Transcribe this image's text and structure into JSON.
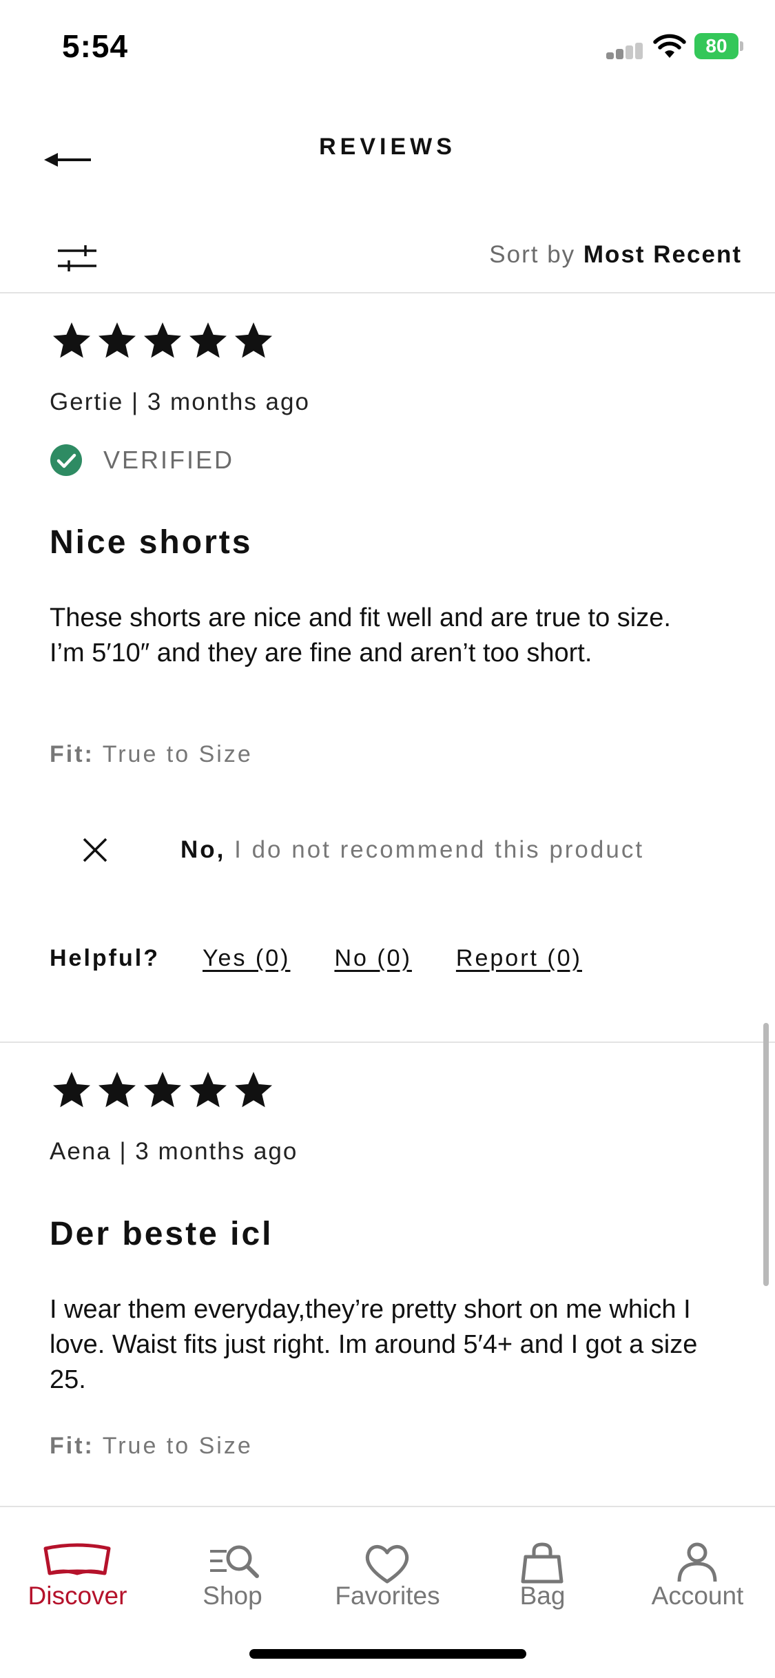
{
  "status_bar": {
    "time": "5:54",
    "battery": "80"
  },
  "header": {
    "title": "REVIEWS"
  },
  "toolbar": {
    "sort_prefix": "Sort by",
    "sort_value": "Most Recent"
  },
  "reviews": [
    {
      "rating": 5,
      "reviewer": "Gertie | 3 months ago",
      "verified": "VERIFIED",
      "title": "Nice shorts",
      "body": "These shorts are nice and fit well and are true to size. I’m 5′10″ and they are fine and aren’t too short.",
      "fit_label": "Fit:",
      "fit_value": "True to Size",
      "recommend_answer": "No,",
      "recommend_text": "I do not recommend this product",
      "helpful_label": "Helpful?",
      "helpful_yes": "Yes (0)",
      "helpful_no": "No (0)",
      "report": "Report (0)"
    },
    {
      "rating": 5,
      "reviewer": "Aena | 3 months ago",
      "title": "Der beste icl",
      "body": "I wear them everyday,they’re pretty short on me which I love. Waist fits just right. Im around 5′4+ and I got a size 25.",
      "fit_label": "Fit:",
      "fit_value": "True to Size"
    }
  ],
  "tabs": [
    {
      "label": "Discover",
      "icon": "discover-icon",
      "active": true
    },
    {
      "label": "Shop",
      "icon": "shop-search-icon",
      "active": false
    },
    {
      "label": "Favorites",
      "icon": "heart-icon",
      "active": false
    },
    {
      "label": "Bag",
      "icon": "bag-icon",
      "active": false
    },
    {
      "label": "Account",
      "icon": "account-icon",
      "active": false
    }
  ],
  "colors": {
    "brand_red": "#b5122b",
    "verified_green": "#2e8b63",
    "muted_text": "#777777",
    "battery_green": "#34c759"
  }
}
